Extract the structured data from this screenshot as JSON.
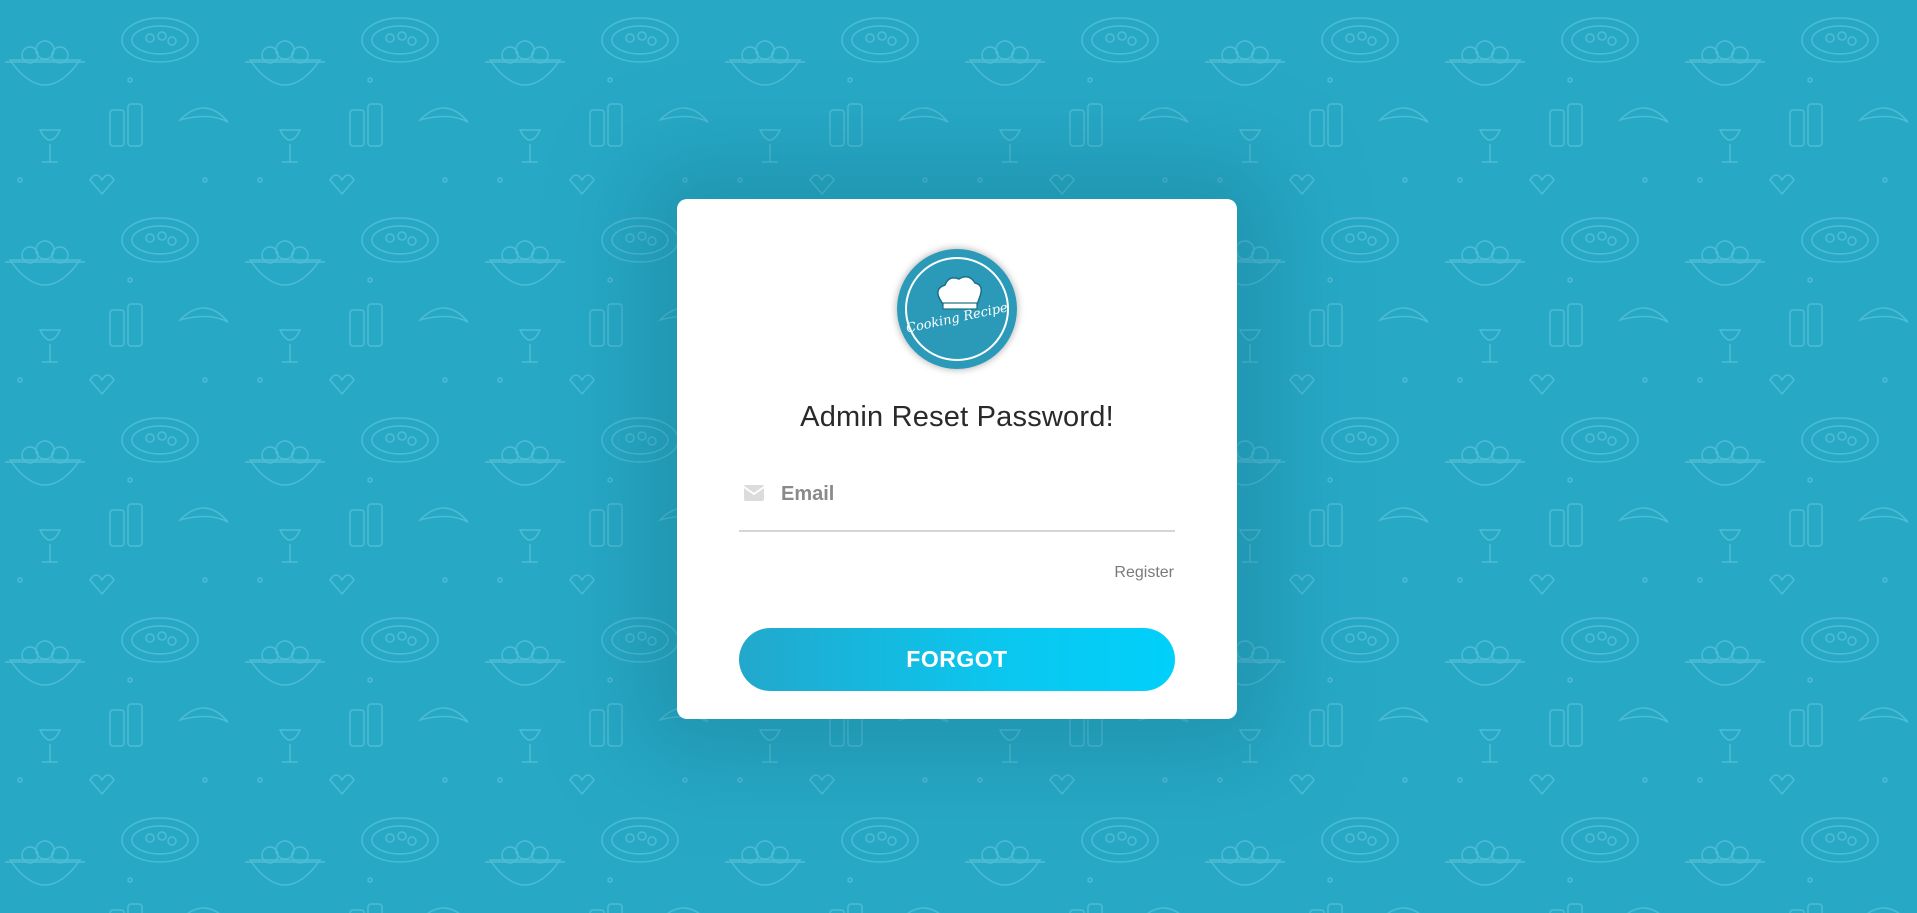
{
  "page": {
    "background_color": "#27a9c6",
    "pattern_color": "#5cc3da"
  },
  "logo": {
    "text": "Cooking Recipe",
    "icon": "chef-hat-icon"
  },
  "form": {
    "title": "Admin Reset Password!",
    "email": {
      "placeholder": "Email",
      "value": "",
      "icon": "envelope-icon"
    },
    "register_label": "Register",
    "submit_label": "FORGOT",
    "accent_gradient": [
      "#22a8cc",
      "#00d0fb"
    ]
  }
}
